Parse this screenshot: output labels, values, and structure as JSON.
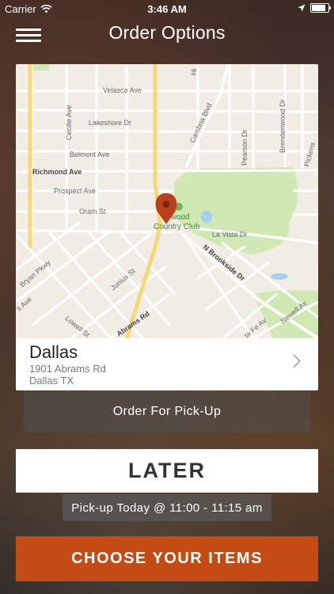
{
  "status_bar": {
    "carrier": "Carrier",
    "time": "3:46 AM",
    "battery_level": 0.85
  },
  "header": {
    "title": "Order Options",
    "menu_icon": "hamburger-menu-icon"
  },
  "map": {
    "labels": {
      "velasco": "Velasco Ave",
      "lakeshore": "Lakeshore Dr",
      "belmont": "Belmont Ave",
      "richmond": "Richmond Ave",
      "prospect": "Prospect Ave",
      "oram": "Oram St",
      "cecille": "Cecille Ave",
      "cambria": "Cambria Blvd",
      "pearson": "Pearson Dr",
      "brendenwood": "Brendenwood Dr",
      "pickens": "Pickens",
      "lavista": "La Vista Dr",
      "brookside": "N Brookside Dr",
      "junius": "Junius St",
      "abrams": "Abrams Rd",
      "lowell": "Lowell St",
      "bryan": "Bryan Pkwy",
      "swiss": "s Ave",
      "newell": "Newell Av",
      "fe": "ta Fe Av",
      "hi": "Hi",
      "lakewood_cc_1": "ewood",
      "lakewood_cc_2": "Country Club"
    },
    "pin_color": "#b8401c",
    "park_color": "#cfe8b4"
  },
  "location": {
    "name": "Dallas",
    "address_line1": "1901 Abrams Rd",
    "address_line2": "Dallas TX"
  },
  "order_type": "Order For Pick-Up",
  "later_label": "LATER",
  "pickup_time": "Pick-up Today @ 11:00 - 11:15 am",
  "cta_label": "CHOOSE YOUR ITEMS",
  "colors": {
    "cta": "#c44b13"
  }
}
